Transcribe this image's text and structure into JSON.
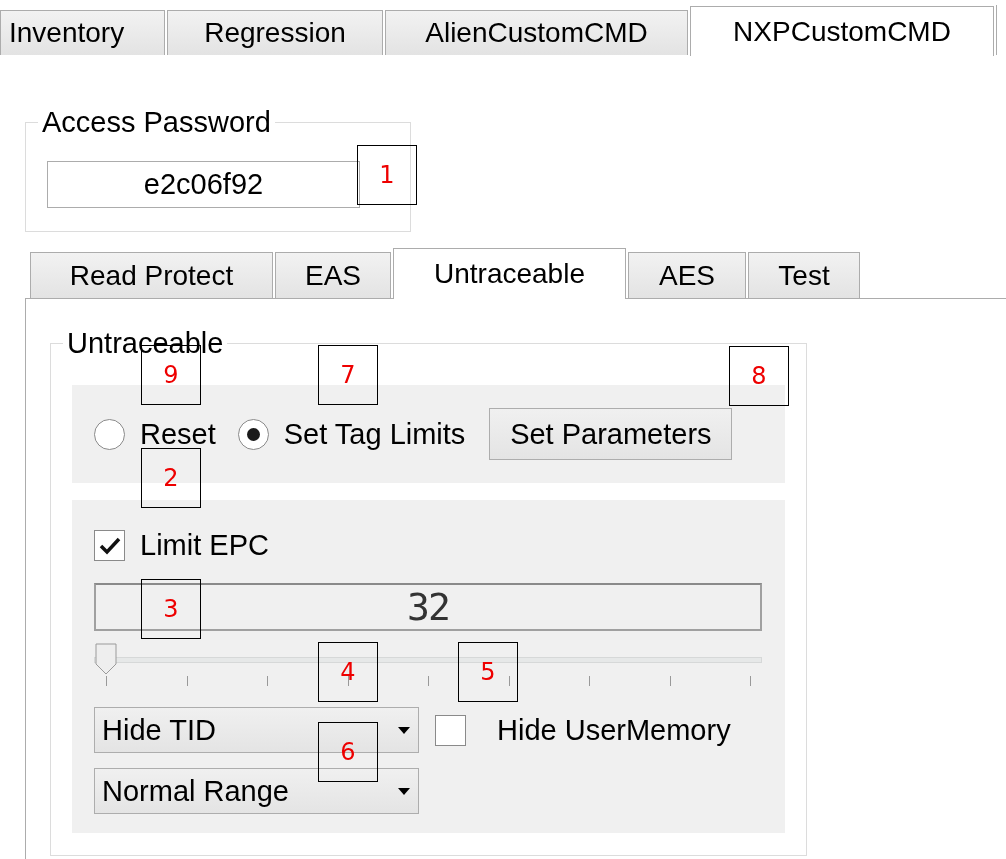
{
  "main_tabs": [
    {
      "label": "Inventory",
      "selected": false
    },
    {
      "label": "Regression",
      "selected": false
    },
    {
      "label": "AlienCustomCMD",
      "selected": false
    },
    {
      "label": "NXPCustomCMD",
      "selected": true
    }
  ],
  "access_password": {
    "label": "Access Password",
    "value": "e2c06f92"
  },
  "sub_tabs": [
    {
      "label": "Read Protect",
      "selected": false
    },
    {
      "label": "EAS",
      "selected": false
    },
    {
      "label": "Untraceable",
      "selected": true
    },
    {
      "label": "AES",
      "selected": false
    },
    {
      "label": "Test",
      "selected": false
    }
  ],
  "untraceable": {
    "title": "Untraceable",
    "mode_options": [
      {
        "label": "Reset",
        "selected": false
      },
      {
        "label": "Set Tag Limits",
        "selected": true
      }
    ],
    "set_parameters_button": "Set Parameters",
    "limit_epc": {
      "label": "Limit EPC",
      "checked": true
    },
    "epc_display": "32",
    "epc_slider": {
      "level": 0
    },
    "tid_dropdown": {
      "value": "Hide TID"
    },
    "hide_user_memory": {
      "label": "Hide UserMemory",
      "checked": false
    },
    "range_dropdown": {
      "value": "Normal Range"
    }
  },
  "callouts": [
    {
      "label": "1"
    },
    {
      "label": "9"
    },
    {
      "label": "7"
    },
    {
      "label": "8"
    },
    {
      "label": "2"
    },
    {
      "label": "3"
    },
    {
      "label": "4"
    },
    {
      "label": "5"
    },
    {
      "label": "6"
    }
  ]
}
